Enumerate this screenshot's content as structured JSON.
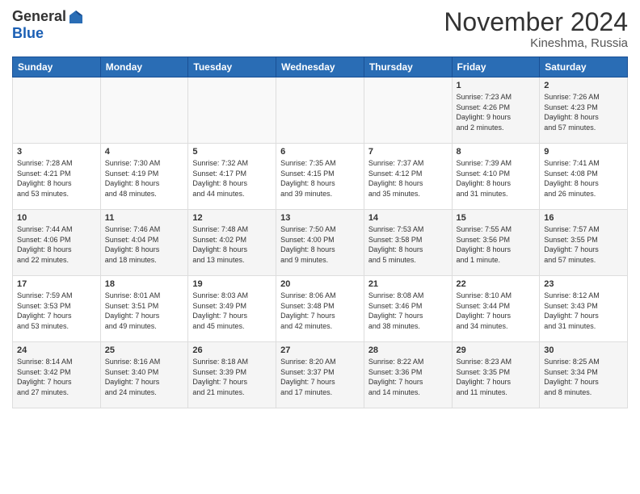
{
  "logo": {
    "general": "General",
    "blue": "Blue"
  },
  "header": {
    "month": "November 2024",
    "location": "Kineshma, Russia"
  },
  "weekdays": [
    "Sunday",
    "Monday",
    "Tuesday",
    "Wednesday",
    "Thursday",
    "Friday",
    "Saturday"
  ],
  "weeks": [
    [
      {
        "day": "",
        "info": ""
      },
      {
        "day": "",
        "info": ""
      },
      {
        "day": "",
        "info": ""
      },
      {
        "day": "",
        "info": ""
      },
      {
        "day": "",
        "info": ""
      },
      {
        "day": "1",
        "info": "Sunrise: 7:23 AM\nSunset: 4:26 PM\nDaylight: 9 hours\nand 2 minutes."
      },
      {
        "day": "2",
        "info": "Sunrise: 7:26 AM\nSunset: 4:23 PM\nDaylight: 8 hours\nand 57 minutes."
      }
    ],
    [
      {
        "day": "3",
        "info": "Sunrise: 7:28 AM\nSunset: 4:21 PM\nDaylight: 8 hours\nand 53 minutes."
      },
      {
        "day": "4",
        "info": "Sunrise: 7:30 AM\nSunset: 4:19 PM\nDaylight: 8 hours\nand 48 minutes."
      },
      {
        "day": "5",
        "info": "Sunrise: 7:32 AM\nSunset: 4:17 PM\nDaylight: 8 hours\nand 44 minutes."
      },
      {
        "day": "6",
        "info": "Sunrise: 7:35 AM\nSunset: 4:15 PM\nDaylight: 8 hours\nand 39 minutes."
      },
      {
        "day": "7",
        "info": "Sunrise: 7:37 AM\nSunset: 4:12 PM\nDaylight: 8 hours\nand 35 minutes."
      },
      {
        "day": "8",
        "info": "Sunrise: 7:39 AM\nSunset: 4:10 PM\nDaylight: 8 hours\nand 31 minutes."
      },
      {
        "day": "9",
        "info": "Sunrise: 7:41 AM\nSunset: 4:08 PM\nDaylight: 8 hours\nand 26 minutes."
      }
    ],
    [
      {
        "day": "10",
        "info": "Sunrise: 7:44 AM\nSunset: 4:06 PM\nDaylight: 8 hours\nand 22 minutes."
      },
      {
        "day": "11",
        "info": "Sunrise: 7:46 AM\nSunset: 4:04 PM\nDaylight: 8 hours\nand 18 minutes."
      },
      {
        "day": "12",
        "info": "Sunrise: 7:48 AM\nSunset: 4:02 PM\nDaylight: 8 hours\nand 13 minutes."
      },
      {
        "day": "13",
        "info": "Sunrise: 7:50 AM\nSunset: 4:00 PM\nDaylight: 8 hours\nand 9 minutes."
      },
      {
        "day": "14",
        "info": "Sunrise: 7:53 AM\nSunset: 3:58 PM\nDaylight: 8 hours\nand 5 minutes."
      },
      {
        "day": "15",
        "info": "Sunrise: 7:55 AM\nSunset: 3:56 PM\nDaylight: 8 hours\nand 1 minute."
      },
      {
        "day": "16",
        "info": "Sunrise: 7:57 AM\nSunset: 3:55 PM\nDaylight: 7 hours\nand 57 minutes."
      }
    ],
    [
      {
        "day": "17",
        "info": "Sunrise: 7:59 AM\nSunset: 3:53 PM\nDaylight: 7 hours\nand 53 minutes."
      },
      {
        "day": "18",
        "info": "Sunrise: 8:01 AM\nSunset: 3:51 PM\nDaylight: 7 hours\nand 49 minutes."
      },
      {
        "day": "19",
        "info": "Sunrise: 8:03 AM\nSunset: 3:49 PM\nDaylight: 7 hours\nand 45 minutes."
      },
      {
        "day": "20",
        "info": "Sunrise: 8:06 AM\nSunset: 3:48 PM\nDaylight: 7 hours\nand 42 minutes."
      },
      {
        "day": "21",
        "info": "Sunrise: 8:08 AM\nSunset: 3:46 PM\nDaylight: 7 hours\nand 38 minutes."
      },
      {
        "day": "22",
        "info": "Sunrise: 8:10 AM\nSunset: 3:44 PM\nDaylight: 7 hours\nand 34 minutes."
      },
      {
        "day": "23",
        "info": "Sunrise: 8:12 AM\nSunset: 3:43 PM\nDaylight: 7 hours\nand 31 minutes."
      }
    ],
    [
      {
        "day": "24",
        "info": "Sunrise: 8:14 AM\nSunset: 3:42 PM\nDaylight: 7 hours\nand 27 minutes."
      },
      {
        "day": "25",
        "info": "Sunrise: 8:16 AM\nSunset: 3:40 PM\nDaylight: 7 hours\nand 24 minutes."
      },
      {
        "day": "26",
        "info": "Sunrise: 8:18 AM\nSunset: 3:39 PM\nDaylight: 7 hours\nand 21 minutes."
      },
      {
        "day": "27",
        "info": "Sunrise: 8:20 AM\nSunset: 3:37 PM\nDaylight: 7 hours\nand 17 minutes."
      },
      {
        "day": "28",
        "info": "Sunrise: 8:22 AM\nSunset: 3:36 PM\nDaylight: 7 hours\nand 14 minutes."
      },
      {
        "day": "29",
        "info": "Sunrise: 8:23 AM\nSunset: 3:35 PM\nDaylight: 7 hours\nand 11 minutes."
      },
      {
        "day": "30",
        "info": "Sunrise: 8:25 AM\nSunset: 3:34 PM\nDaylight: 7 hours\nand 8 minutes."
      }
    ]
  ]
}
